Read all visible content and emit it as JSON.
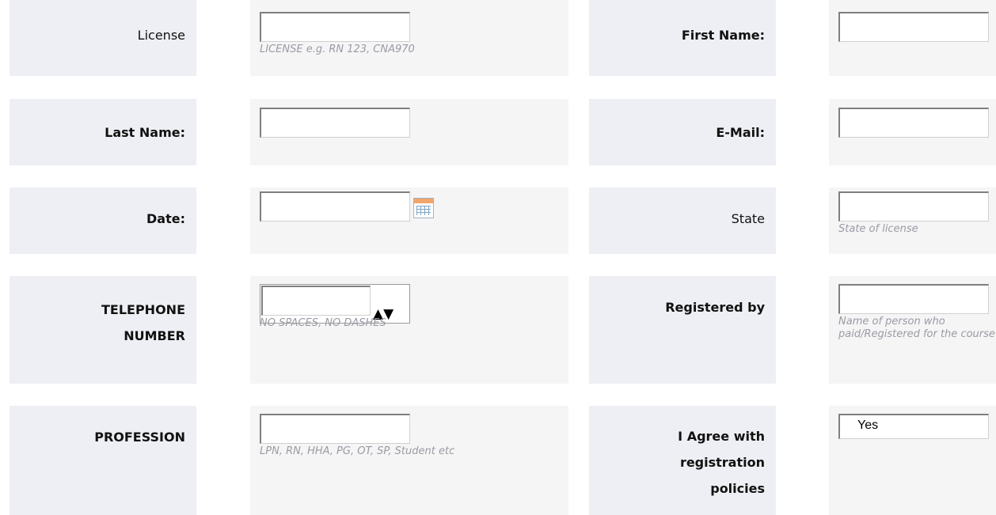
{
  "rows": {
    "license": {
      "label": "License",
      "hint": "LICENSE e.g. RN 123, CNA970",
      "value": ""
    },
    "first_name": {
      "label": "First Name:",
      "value": ""
    },
    "last_name": {
      "label": "Last Name:",
      "value": ""
    },
    "email": {
      "label": "E-Mail:",
      "value": ""
    },
    "date": {
      "label": "Date:",
      "value": "",
      "icon": "calendar-icon"
    },
    "state": {
      "label": "State",
      "hint": "State of license",
      "value": ""
    },
    "telephone": {
      "label_line1": "TELEPHONE",
      "label_line2": "NUMBER",
      "hint": "NO SPACES, NO DASHES",
      "value": "",
      "up": "▲",
      "down": "▼"
    },
    "registered_by": {
      "label": "Registered by",
      "hint": "Name of person who paid/Registered for the course",
      "value": ""
    },
    "profession": {
      "label": "PROFESSION",
      "hint": "LPN, RN, HHA, PG, OT, SP, Student etc",
      "value": ""
    },
    "agree": {
      "label_line1": "I Agree with",
      "label_line2": "registration",
      "label_line3": "policies",
      "selected": "Yes"
    }
  },
  "colors": {
    "label_bg": "#eeeff4",
    "field_bg": "#f5f5f5",
    "hint": "#9a9aa6"
  }
}
